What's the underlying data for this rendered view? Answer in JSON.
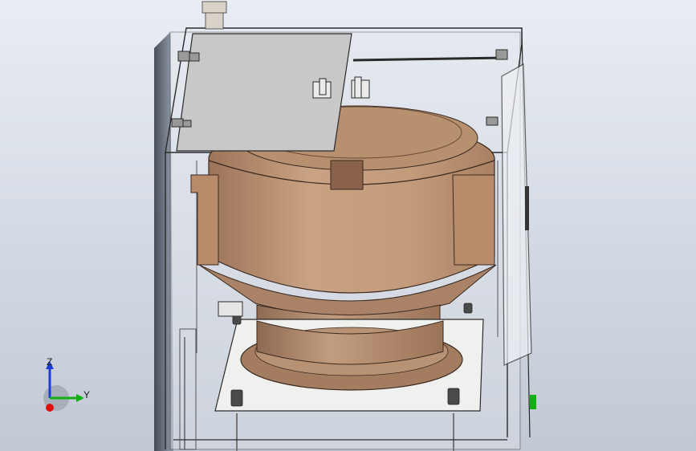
{
  "viewport": {
    "background_top": "#e9edf4",
    "background_bottom": "#c2c9d4"
  },
  "model": {
    "bowl_color": "#c7a07f",
    "cover_color": "#c8c8c8",
    "frame_color": "#2a2a2a"
  },
  "triad": {
    "z_label": "Z",
    "y_label": "Y",
    "x_axis_color": "#e01010",
    "y_axis_color": "#10b010",
    "z_axis_color": "#1c3dd8"
  }
}
